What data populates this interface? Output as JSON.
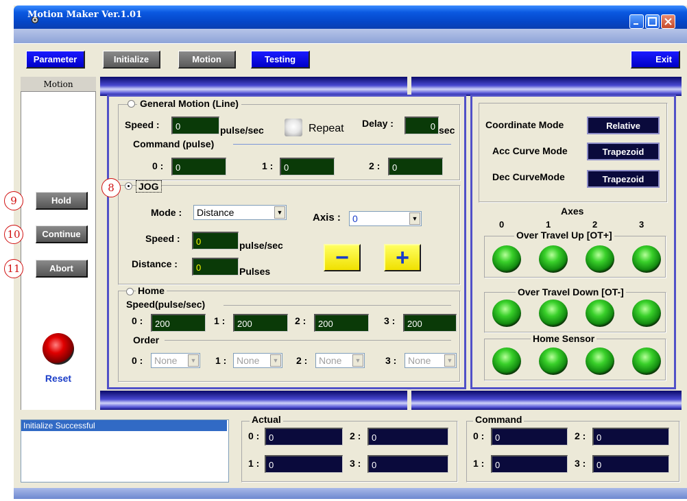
{
  "window": {
    "title": "Motion Maker Ver.1.01"
  },
  "toolbar": {
    "parameter": "Parameter",
    "initialize": "Initialize",
    "motion": "Motion",
    "testing": "Testing",
    "exit": "Exit"
  },
  "left": {
    "header": "Motion",
    "hold": "Hold",
    "continue": "Continue",
    "abort": "Abort",
    "reset": "Reset",
    "callouts": {
      "c8": "8",
      "c9": "9",
      "c10": "10",
      "c11": "11"
    }
  },
  "general": {
    "title": "General Motion (Line)",
    "speed_label": "Speed :",
    "speed_value": "0",
    "speed_unit": "pulse/sec",
    "repeat": "Repeat",
    "delay_label": "Delay :",
    "delay_value": "0",
    "delay_unit": "sec",
    "command_label": "Command (pulse)",
    "cmd": [
      {
        "label": "0 :",
        "value": "0"
      },
      {
        "label": "1 :",
        "value": "0"
      },
      {
        "label": "2 :",
        "value": "0"
      }
    ]
  },
  "jog": {
    "title": "JOG",
    "mode_label": "Mode :",
    "mode_value": "Distance",
    "axis_label": "Axis :",
    "axis_value": "0",
    "speed_label": "Speed :",
    "speed_value": "0",
    "speed_unit": "pulse/sec",
    "distance_label": "Distance :",
    "distance_value": "0",
    "distance_unit": "Pulses",
    "minus": "−",
    "plus": "+"
  },
  "home": {
    "title": "Home",
    "speed_label": "Speed(pulse/sec)",
    "speeds": [
      {
        "label": "0 :",
        "value": "200"
      },
      {
        "label": "1 :",
        "value": "200"
      },
      {
        "label": "2 :",
        "value": "200"
      },
      {
        "label": "3 :",
        "value": "200"
      }
    ],
    "order_label": "Order",
    "orders": [
      {
        "label": "0 :",
        "value": "None"
      },
      {
        "label": "1 :",
        "value": "None"
      },
      {
        "label": "2 :",
        "value": "None"
      },
      {
        "label": "3 :",
        "value": "None"
      }
    ]
  },
  "modes": {
    "coordinate_label": "Coordinate Mode",
    "coordinate_value": "Relative",
    "acc_label": "Acc Curve Mode",
    "acc_value": "Trapezoid",
    "dec_label": "Dec CurveMode",
    "dec_value": "Trapezoid"
  },
  "axes": {
    "title": "Axes",
    "labels": [
      "0",
      "1",
      "2",
      "3"
    ],
    "ot_up": "Over Travel Up [OT+]",
    "ot_down": "Over Travel Down [OT-]",
    "home_sensor": "Home Sensor"
  },
  "status": {
    "message": "Initialize Successful"
  },
  "actual": {
    "title": "Actual",
    "items": [
      {
        "label": "0 :",
        "value": "0"
      },
      {
        "label": "2 :",
        "value": "0"
      },
      {
        "label": "1 :",
        "value": "0"
      },
      {
        "label": "3 :",
        "value": "0"
      }
    ]
  },
  "command": {
    "title": "Command",
    "items": [
      {
        "label": "0 :",
        "value": "0"
      },
      {
        "label": "2 :",
        "value": "0"
      },
      {
        "label": "1 :",
        "value": "0"
      },
      {
        "label": "3 :",
        "value": "0"
      }
    ]
  },
  "colors": {
    "field_green": "#0a3a08",
    "field_navy": "#0a0a3c",
    "titlebar_blue": "#0546c8",
    "led_green": "#39d02a"
  }
}
